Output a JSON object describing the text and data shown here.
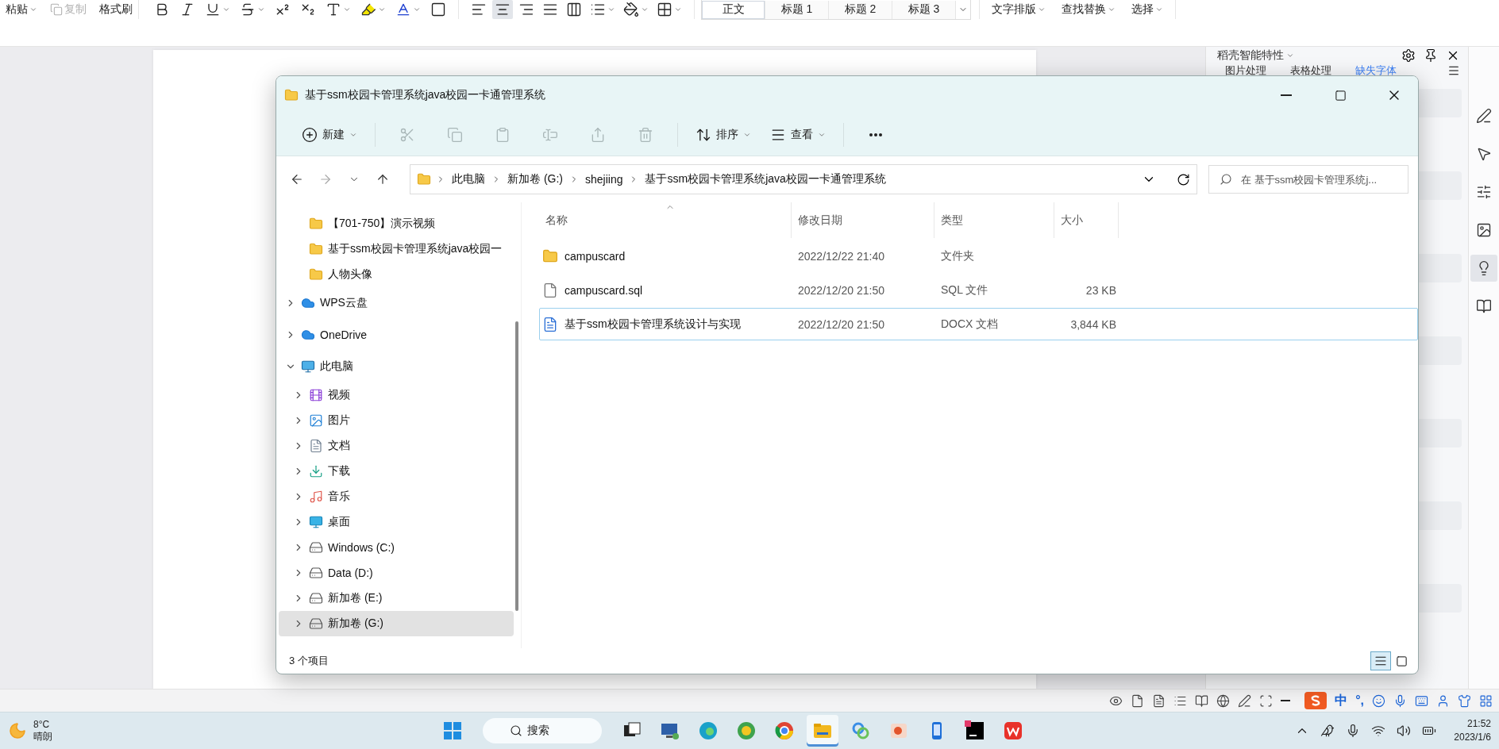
{
  "ribbon": {
    "clipboard": [
      {
        "label": "粘贴",
        "dropdown": true,
        "disabled": false
      },
      {
        "label": "复制",
        "dropdown": false,
        "disabled": true
      },
      {
        "label": "格式刷",
        "dropdown": false,
        "disabled": false
      }
    ],
    "format_tools": [
      {
        "kind": "bold",
        "dropdown": false
      },
      {
        "kind": "italic",
        "dropdown": false
      },
      {
        "kind": "underline",
        "dropdown": true
      },
      {
        "kind": "strike",
        "dropdown": true
      },
      {
        "kind": "superscript",
        "dropdown": false
      },
      {
        "kind": "subscript",
        "dropdown": false
      },
      {
        "kind": "text-effect",
        "dropdown": true
      },
      {
        "kind": "highlight",
        "dropdown": true
      },
      {
        "kind": "font-color",
        "dropdown": true
      },
      {
        "kind": "char-border",
        "dropdown": false
      }
    ],
    "paragraph_tools": [
      {
        "kind": "align-left",
        "selected": false,
        "dropdown": false
      },
      {
        "kind": "align-center",
        "selected": true,
        "dropdown": false
      },
      {
        "kind": "align-right",
        "selected": false,
        "dropdown": false
      },
      {
        "kind": "justify",
        "selected": false,
        "dropdown": false
      },
      {
        "kind": "distribute",
        "selected": false,
        "dropdown": false
      },
      {
        "kind": "line-spacing",
        "selected": false,
        "dropdown": true
      },
      {
        "kind": "shading",
        "selected": false,
        "dropdown": true
      },
      {
        "kind": "borders",
        "selected": false,
        "dropdown": true
      }
    ],
    "styles": [
      {
        "label": "正文",
        "selected": true
      },
      {
        "label": "标题 1",
        "selected": false
      },
      {
        "label": "标题 2",
        "selected": false
      },
      {
        "label": "标题 3",
        "selected": false
      }
    ],
    "menus": [
      "文字排版",
      "查找替换",
      "选择"
    ]
  },
  "side_panel": {
    "title": "稻壳智能特性",
    "tabs": [
      {
        "label": "图片处理",
        "selected": false
      },
      {
        "label": "表格处理",
        "selected": false
      },
      {
        "label": "缺失字体",
        "selected": true
      }
    ]
  },
  "side_strip": [
    {
      "kind": "pen",
      "selected": false
    },
    {
      "kind": "cursor",
      "selected": false
    },
    {
      "kind": "sliders",
      "selected": false
    },
    {
      "kind": "image",
      "selected": false
    },
    {
      "kind": "bulb",
      "selected": true
    },
    {
      "kind": "book",
      "selected": false
    }
  ],
  "explorer": {
    "title": "基于ssm校园卡管理系统java校园一卡通管理系统",
    "commands": [
      {
        "kind": "new",
        "label": "新建",
        "disabled": false
      },
      {
        "kind": "cut",
        "disabled": true
      },
      {
        "kind": "copy",
        "disabled": true
      },
      {
        "kind": "paste",
        "disabled": true
      },
      {
        "kind": "rename",
        "disabled": true
      },
      {
        "kind": "share",
        "disabled": true
      },
      {
        "kind": "delete",
        "disabled": true
      },
      {
        "kind": "sort",
        "label": "排序",
        "disabled": false
      },
      {
        "kind": "view",
        "label": "查看",
        "disabled": false
      },
      {
        "kind": "more",
        "disabled": false
      }
    ],
    "nav_buttons": [
      {
        "kind": "back",
        "disabled": false
      },
      {
        "kind": "forward",
        "disabled": true
      },
      {
        "kind": "recent",
        "disabled": false
      },
      {
        "kind": "up",
        "disabled": false
      }
    ],
    "breadcrumb": [
      "此电脑",
      "新加卷 (G:)",
      "shejiing",
      "基于ssm校园卡管理系统java校园一卡通管理系统"
    ],
    "search": {
      "placeholder": "在 基于ssm校园卡管理系统j..."
    },
    "quick_access": [
      {
        "label": "【701-750】演示视频",
        "kind": "folder",
        "selected": false
      },
      {
        "label": "基于ssm校园卡管理系统java校园一",
        "kind": "folder",
        "selected": false
      },
      {
        "label": "人物头像",
        "kind": "folder",
        "selected": false
      }
    ],
    "nav": [
      {
        "label": "WPS云盘",
        "kind": "cloud",
        "expanded": false,
        "selected": false
      },
      {
        "label": "OneDrive",
        "kind": "cloud",
        "expanded": false,
        "selected": false
      },
      {
        "label": "此电脑",
        "kind": "computer",
        "expanded": true,
        "selected": false,
        "children": [
          {
            "label": "视频",
            "kind": "video",
            "expanded": false,
            "selected": false
          },
          {
            "label": "图片",
            "kind": "pictures",
            "expanded": false,
            "selected": false
          },
          {
            "label": "文档",
            "kind": "documents",
            "expanded": false,
            "selected": false
          },
          {
            "label": "下载",
            "kind": "downloads",
            "expanded": false,
            "selected": false
          },
          {
            "label": "音乐",
            "kind": "music",
            "expanded": false,
            "selected": false
          },
          {
            "label": "桌面",
            "kind": "desktop",
            "expanded": false,
            "selected": false
          },
          {
            "label": "Windows (C:)",
            "kind": "drive",
            "expanded": false,
            "selected": false
          },
          {
            "label": "Data (D:)",
            "kind": "drive",
            "expanded": false,
            "selected": false
          },
          {
            "label": "新加卷 (E:)",
            "kind": "drive",
            "expanded": false,
            "selected": false
          },
          {
            "label": "新加卷 (G:)",
            "kind": "drive",
            "expanded": false,
            "selected": true
          }
        ]
      }
    ],
    "columns": [
      {
        "label": "名称",
        "sorted": true
      },
      {
        "label": "修改日期",
        "sorted": false
      },
      {
        "label": "类型",
        "sorted": false
      },
      {
        "label": "大小",
        "sorted": false
      }
    ],
    "files": [
      {
        "kind": "folder",
        "name": "campuscard",
        "modified": "2022/12/22 21:40",
        "type": "文件夹",
        "focused": false
      },
      {
        "kind": "file",
        "name": "campuscard.sql",
        "modified": "2022/12/20 21:50",
        "type": "SQL 文件",
        "size": "23 KB",
        "focused": false
      },
      {
        "kind": "word",
        "name": "基于ssm校园卡管理系统设计与实现",
        "modified": "2022/12/20 21:50",
        "type": "DOCX 文档",
        "size": "3,844 KB",
        "focused": true
      }
    ],
    "status": "3 个项目",
    "views": [
      {
        "kind": "details",
        "selected": true
      },
      {
        "kind": "tiles",
        "selected": false
      }
    ]
  },
  "status_tools": [
    {
      "kind": "eye"
    },
    {
      "kind": "file"
    },
    {
      "kind": "doc"
    },
    {
      "kind": "list"
    },
    {
      "kind": "book"
    },
    {
      "kind": "globe"
    },
    {
      "kind": "pen"
    },
    {
      "kind": "focus"
    },
    {
      "kind": "minus"
    }
  ],
  "ime": {
    "mode": "中",
    "punct": "°,",
    "tools": [
      {
        "kind": "smile"
      },
      {
        "kind": "mic"
      },
      {
        "kind": "keyboard"
      },
      {
        "kind": "user"
      },
      {
        "kind": "shirt"
      },
      {
        "kind": "grid"
      }
    ]
  },
  "taskbar": {
    "weather": {
      "temp": "8°C",
      "condition": "晴朗"
    },
    "search": "搜索",
    "apps": [
      {
        "kind": "taskview",
        "selected": false
      },
      {
        "kind": "remote",
        "selected": false
      },
      {
        "kind": "edge",
        "selected": false
      },
      {
        "kind": "browser",
        "selected": false
      },
      {
        "kind": "chrome",
        "selected": false
      },
      {
        "kind": "explorer",
        "selected": true
      },
      {
        "kind": "rings",
        "selected": false
      },
      {
        "kind": "slides",
        "selected": false
      },
      {
        "kind": "phone",
        "selected": false
      },
      {
        "kind": "ide",
        "selected": false
      },
      {
        "kind": "wps",
        "selected": false
      }
    ],
    "tray": [
      {
        "kind": "chevron"
      },
      {
        "kind": "penguin"
      },
      {
        "kind": "mic"
      },
      {
        "kind": "wifi"
      },
      {
        "kind": "volume"
      },
      {
        "kind": "battery"
      }
    ],
    "time": "21:52",
    "date": "2023/1/6"
  }
}
